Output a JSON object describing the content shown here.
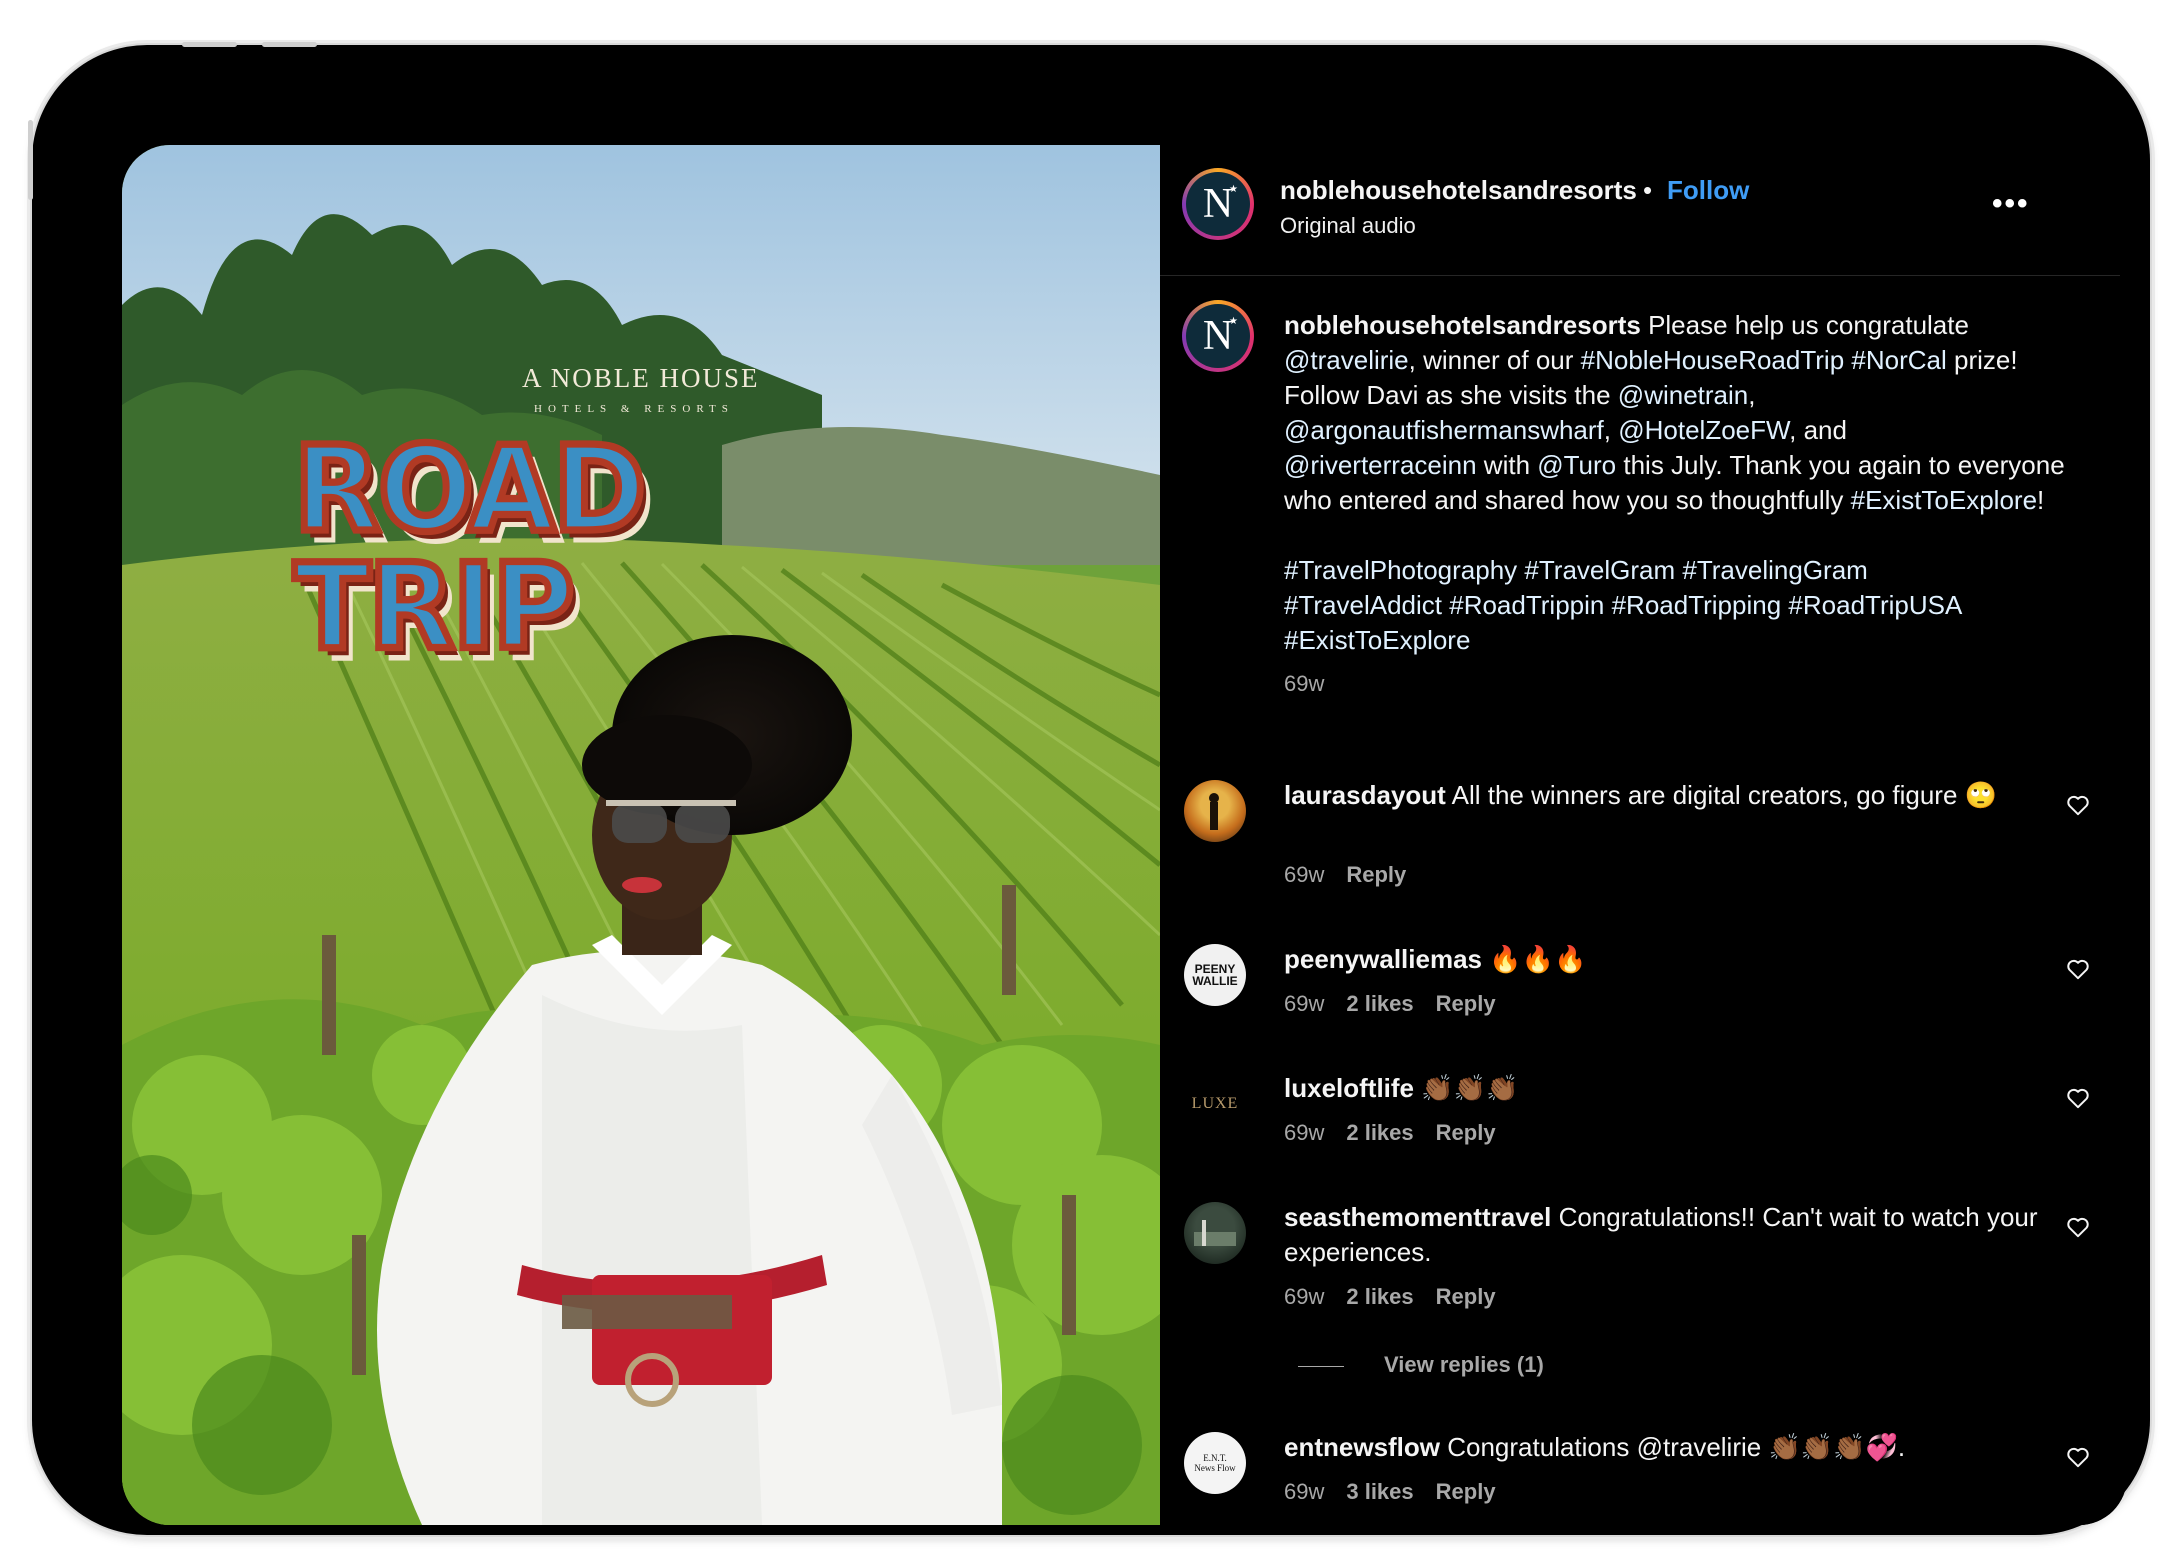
{
  "post": {
    "username": "noblehousehotelsandresorts",
    "separator": "•",
    "follow_label": "Follow",
    "audio": "Original audio",
    "more_label": "•••",
    "avatar_letter": "N",
    "avatar_star": "★"
  },
  "media": {
    "brand_line1": "A NOBLE HOUSE",
    "brand_line2": "HOTELS & RESORTS",
    "headline": "ROAD TRIP"
  },
  "caption": {
    "username": "noblehousehotelsandresorts",
    "text_1": " Please help us congratulate ",
    "mention_1": "@travelirie",
    "text_2": ", winner of our ",
    "tag_1": "#NobleHouseRoadTrip",
    "tag_2": "#NorCal",
    "text_3": " prize! Follow Davi as she visits the ",
    "mention_2": "@winetrain",
    "text_4": ", ",
    "mention_3": "@argonautfishermanswharf",
    "mention_4": "@HotelZoeFW",
    "text_5": ", and ",
    "mention_5": "@riverterraceinn",
    "text_6": " with ",
    "mention_6": "@Turo",
    "text_7": " this July. Thank you again to everyone who entered and shared how you so thoughtfully ",
    "tag_3": "#ExistToExplore",
    "text_8": "!",
    "hashtags": [
      "#TravelPhotography",
      "#TravelGram",
      "#TravelingGram",
      "#TravelAddict",
      "#RoadTrippin",
      "#RoadTripping",
      "#RoadTripUSA",
      "#ExistToExplore"
    ],
    "time": "69w"
  },
  "comments": [
    {
      "username": "laurasdayout",
      "text": " All the winners are digital creators, go figure 🙄",
      "time": "69w",
      "likes": "",
      "reply": "Reply"
    },
    {
      "username": "peenywalliemas",
      "text": " 🔥🔥🔥",
      "time": "69w",
      "likes": "2 likes",
      "reply": "Reply",
      "avatar_text": "PEENY WALLIE"
    },
    {
      "username": "luxeloftlife",
      "text": " 👏🏾👏🏾👏🏾",
      "time": "69w",
      "likes": "2 likes",
      "reply": "Reply",
      "avatar_text": "LUXE"
    },
    {
      "username": "seasthemomenttravel",
      "text": " Congratulations!! Can't wait to watch your experiences.",
      "time": "69w",
      "likes": "2 likes",
      "reply": "Reply",
      "view_replies": "View replies (1)"
    },
    {
      "username": "entnewsflow",
      "text": " Congratulations @travelirie 👏🏾👏🏾👏🏾💞.",
      "time": "69w",
      "likes": "3 likes",
      "reply": "Reply",
      "avatar_text": "E.N.T. News Flow"
    }
  ],
  "colors": {
    "follow": "#3f9cf5",
    "panel_bg": "#000000",
    "muted": "#a8a8a8"
  },
  "icons": [
    "more-icon",
    "heart-icon"
  ]
}
